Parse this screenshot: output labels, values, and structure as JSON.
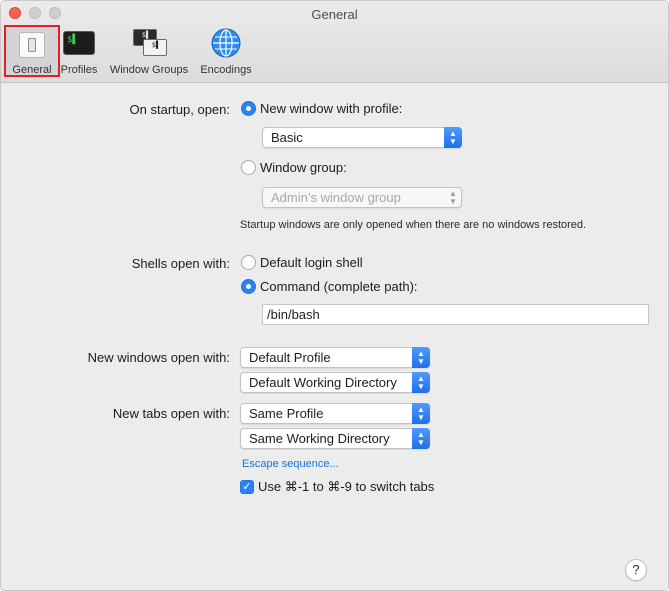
{
  "window": {
    "title": "General"
  },
  "toolbar": {
    "items": [
      {
        "label": "General",
        "icon": "switch-icon",
        "selected": true
      },
      {
        "label": "Profiles",
        "icon": "terminal-icon"
      },
      {
        "label": "Window Groups",
        "icon": "window-groups-icon"
      },
      {
        "label": "Encodings",
        "icon": "globe-icon"
      }
    ]
  },
  "startup": {
    "label": "On startup, open:",
    "new_window_option": "New window with profile:",
    "profile_value": "Basic",
    "window_group_option": "Window group:",
    "window_group_value": "Admin’s window group",
    "note": "Startup windows are only opened when there are no windows restored.",
    "selected": "new_window"
  },
  "shells": {
    "label": "Shells open with:",
    "default_option": "Default login shell",
    "command_option": "Command (complete path):",
    "command_value": "/bin/bash",
    "selected": "command"
  },
  "new_windows": {
    "label": "New windows open with:",
    "profile_value": "Default Profile",
    "directory_value": "Default Working Directory"
  },
  "new_tabs": {
    "label": "New tabs open with:",
    "profile_value": "Same Profile",
    "directory_value": "Same Working Directory"
  },
  "escape_link": "Escape sequence...",
  "switch_tabs": {
    "label": "Use ⌘-1 to ⌘-9 to switch tabs",
    "checked": true
  },
  "help_label": "?",
  "colors": {
    "accent": "#2a82f5",
    "highlight_border": "#e0212c",
    "link": "#1a73d9"
  }
}
